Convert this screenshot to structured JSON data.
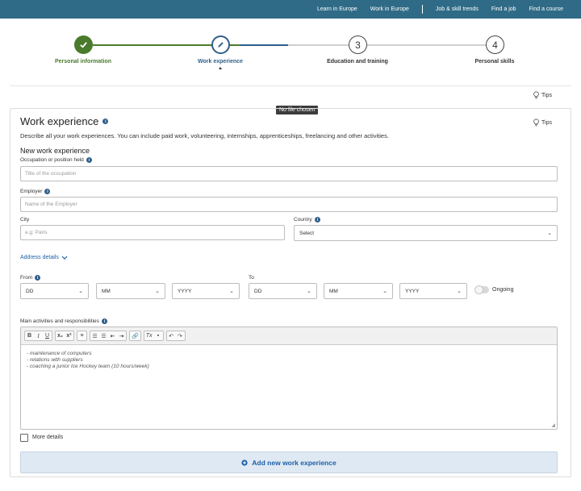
{
  "topnav": {
    "items": [
      "Learn in Europe",
      "Work in Europe",
      "Job & skill trends",
      "Find a job",
      "Find a course"
    ]
  },
  "stepper": {
    "steps": [
      {
        "label": "Personal information",
        "marker": "check",
        "state": "done"
      },
      {
        "label": "Work experience",
        "marker": "pencil",
        "state": "active"
      },
      {
        "label": "Education and training",
        "marker": "3",
        "state": "pending"
      },
      {
        "label": "Personal skills",
        "marker": "4",
        "state": "pending"
      }
    ]
  },
  "tips_label": "Tips",
  "tooltip": "No file chosen",
  "section": {
    "title": "Work experience",
    "tips_label": "Tips",
    "description": "Describe all your work experiences. You can include paid work, volunteering, internships, apprenticeships, freelancing and other activities.",
    "subtitle": "New work experience"
  },
  "form": {
    "occupation": {
      "label": "Occupation or position held",
      "placeholder": "Title of the occupation"
    },
    "employer": {
      "label": "Employer",
      "placeholder": "Name of the Employer"
    },
    "city": {
      "label": "City",
      "placeholder": "e.g: Paris"
    },
    "country": {
      "label": "Country",
      "value": "Select"
    },
    "address_details": "Address details",
    "from": {
      "label": "From",
      "day": "DD",
      "month": "MM",
      "year": "YYYY"
    },
    "to": {
      "label": "To",
      "day": "DD",
      "month": "MM",
      "year": "YYYY"
    },
    "ongoing_label": "Ongoing",
    "activities": {
      "label": "Main activities and responsibilities",
      "lines": [
        "- maintenance of computers",
        "- relations with suppliers",
        "- coaching a junior Ice Hockey team (10 hours/week)"
      ]
    },
    "more_details": "More details",
    "add_button": "Add new work experience"
  },
  "colors": {
    "topbar": "#2f6b86",
    "done": "#4a7a2c",
    "active": "#2f5f8a",
    "link": "#1b5fa8"
  }
}
